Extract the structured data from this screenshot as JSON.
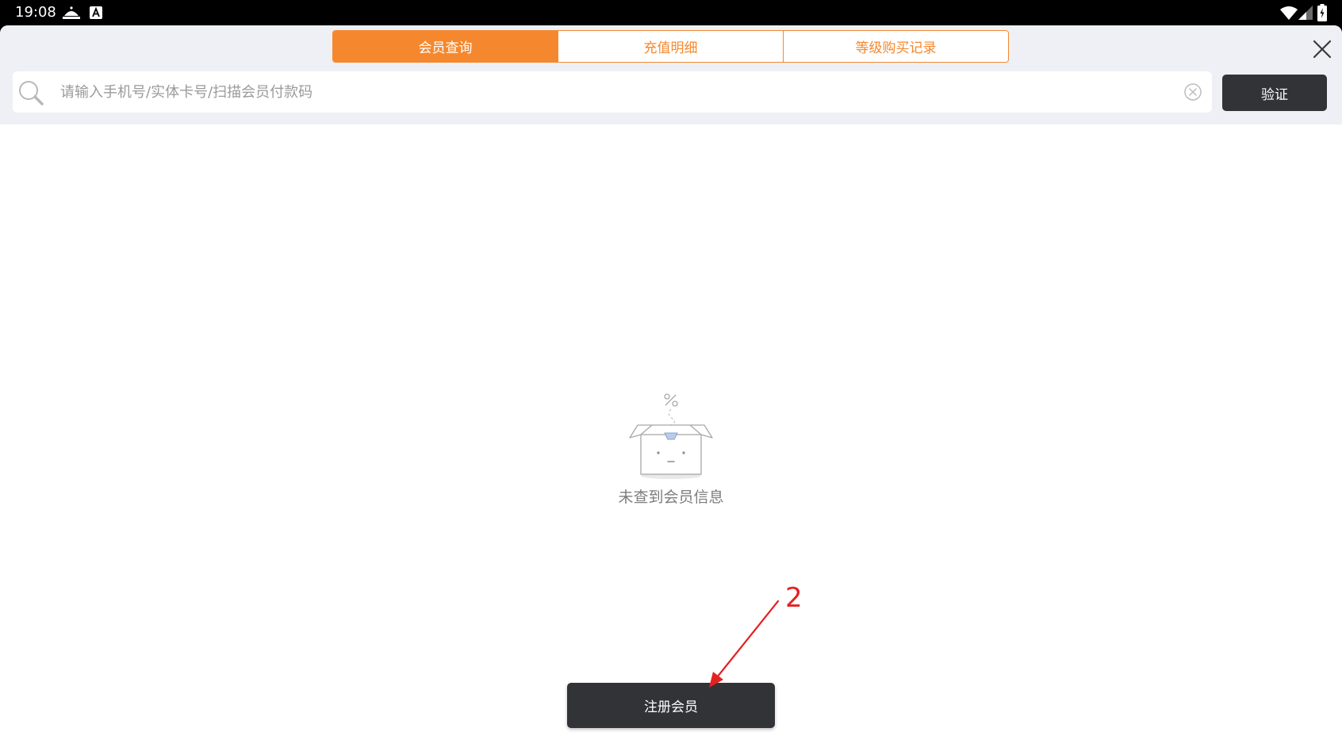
{
  "status_bar": {
    "time": "19:08",
    "left_icons": [
      "notification-icon",
      "text-icon"
    ],
    "right_icons": [
      "wifi-icon",
      "signal-icon",
      "battery-icon"
    ]
  },
  "tabs": [
    {
      "label": "会员查询",
      "active": true
    },
    {
      "label": "充值明细",
      "active": false
    },
    {
      "label": "等级购买记录",
      "active": false
    }
  ],
  "search": {
    "value": "",
    "placeholder": "请输入手机号/实体卡号/扫描会员付款码",
    "verify_label": "验证"
  },
  "empty_state": {
    "message": "未查到会员信息"
  },
  "actions": {
    "register_label": "注册会员"
  },
  "annotation": {
    "number": "2"
  },
  "colors": {
    "accent": "#f5882e",
    "header_bg": "#eef0f5",
    "dark_button": "#323337",
    "annotation": "#e42222"
  }
}
